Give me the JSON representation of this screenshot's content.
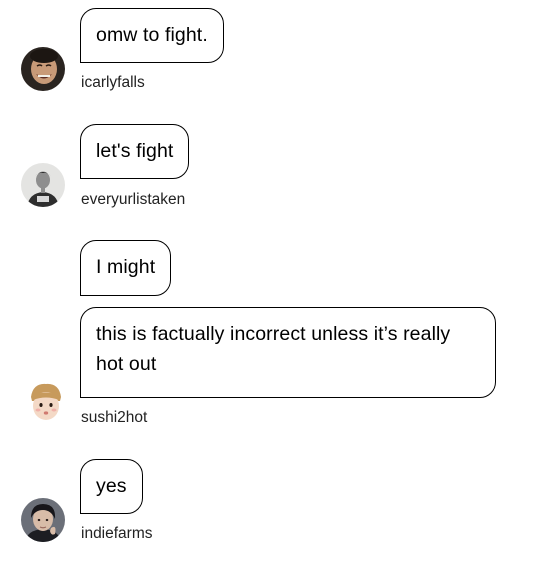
{
  "conversation": [
    {
      "username": "icarlyfalls",
      "avatar_icon": "user-avatar-laughing-face-icon",
      "messages": [
        "omw to fight."
      ]
    },
    {
      "username": "everyurlistaken",
      "avatar_icon": "user-avatar-person-in-tshirt-icon",
      "messages": [
        "let's fight"
      ]
    },
    {
      "username": "sushi2hot",
      "avatar_icon": "user-avatar-cartoon-face-icon",
      "messages": [
        "I might",
        "this is factually incorrect unless it’s really hot out"
      ]
    },
    {
      "username": "indiefarms",
      "avatar_icon": "user-avatar-dark-hair-face-icon",
      "messages": [
        "yes"
      ]
    }
  ],
  "colors": {
    "bubble_border": "#000000",
    "bubble_background": "#ffffff",
    "text": "#000000",
    "page_background": "#ffffff"
  }
}
